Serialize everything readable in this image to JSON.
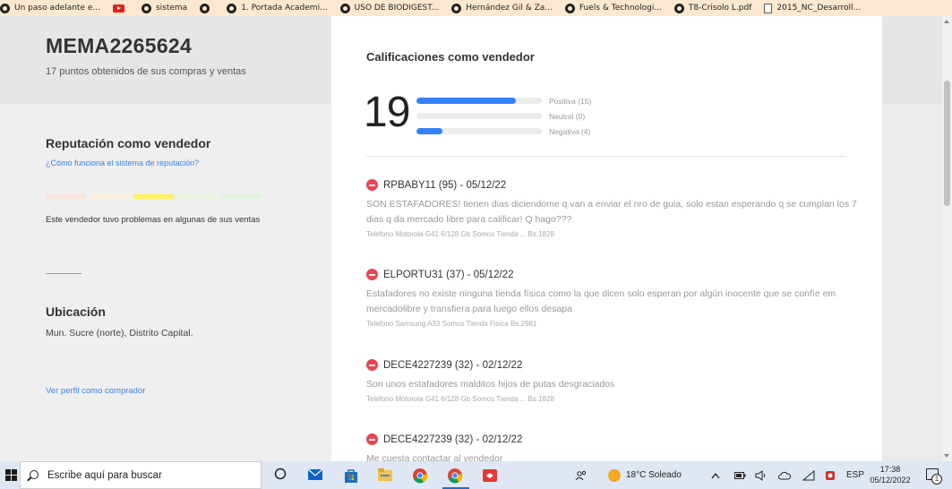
{
  "bookmarks": [
    {
      "label": "Un paso adelante e...",
      "icon": "chrome-icon"
    },
    {
      "label": "",
      "icon": "youtube-icon"
    },
    {
      "label": "sistema",
      "icon": "chrome-icon"
    },
    {
      "label": "",
      "icon": "chrome-icon"
    },
    {
      "label": "1. Portada Academi...",
      "icon": "chrome-icon"
    },
    {
      "label": "USO DE BIODIGEST...",
      "icon": "chrome-icon"
    },
    {
      "label": "Hernández Gil & Za...",
      "icon": "chrome-icon"
    },
    {
      "label": "Fuels & Technologi...",
      "icon": "chrome-icon"
    },
    {
      "label": "T8-Crisolo L.pdf",
      "icon": "chrome-icon"
    },
    {
      "label": "2015_NC_Desarroll...",
      "icon": "pdf-icon"
    }
  ],
  "profile": {
    "username": "MEMA2265624",
    "points": "17 puntos obtenidos de sus compras y ventas"
  },
  "reputation": {
    "title": "Reputación como vendedor",
    "link": "¿Cómo funciona el sistema de reputación?",
    "thermometer": [
      "#fbe3dd",
      "#fdeede",
      "#fff159",
      "#e8f5dd",
      "#e0f2da"
    ],
    "active_level": 3,
    "description": "Este vendedor tuvo problemas en algunas de sus ventas"
  },
  "location": {
    "title": "Ubicación",
    "value": "Mun. Sucre (norte), Distrito Capital."
  },
  "buyer_link": "Ver perfil como comprador",
  "ratings": {
    "title": "Calificaciones como vendedor",
    "total": "19",
    "rows": [
      {
        "label": "Positiva (15)",
        "count": 15
      },
      {
        "label": "Neutral (0)",
        "count": 0
      },
      {
        "label": "Negativa (4)",
        "count": 4
      }
    ]
  },
  "reviews": [
    {
      "header": "RPBABY11 (95) - 05/12/22",
      "text": "SON ESTAFADORES! tienen dias diciendome q van a enviar el nro de guia, solo estan esperando q se cumplan los 7 dias q da mercado libre para calificar! Q hago???",
      "product": "Telefono Motorola G41 6/128 Gb Somos Tienda ...   Bs.1828"
    },
    {
      "header": "ELPORTU31 (37) - 05/12/22",
      "text": "Estafadores no existe ninguna tienda física como la que dicen solo esperan por algún inocente que se confíe em mercadolibre y transfiera para luego ellos desapa",
      "product": "Telefono Samsung A33 Somos Tienda Fisica Bs.2981"
    },
    {
      "header": "DECE4227239 (32) - 02/12/22",
      "text": "Son unos estafadores malditos hijos de putas desgraciados",
      "product": "Telefono Motorola G41 6/128 Gb Somos Tienda ...   Bs.1828"
    },
    {
      "header": "DECE4227239 (32) - 02/12/22",
      "text": "Me cuesta contactar al vendedor",
      "product": ""
    }
  ],
  "taskbar": {
    "search_placeholder": "Escribe aquí para buscar",
    "weather": "18°C  Soleado",
    "language": "ESP",
    "time": "17:38",
    "date": "05/12/2022",
    "notifications": "1"
  }
}
